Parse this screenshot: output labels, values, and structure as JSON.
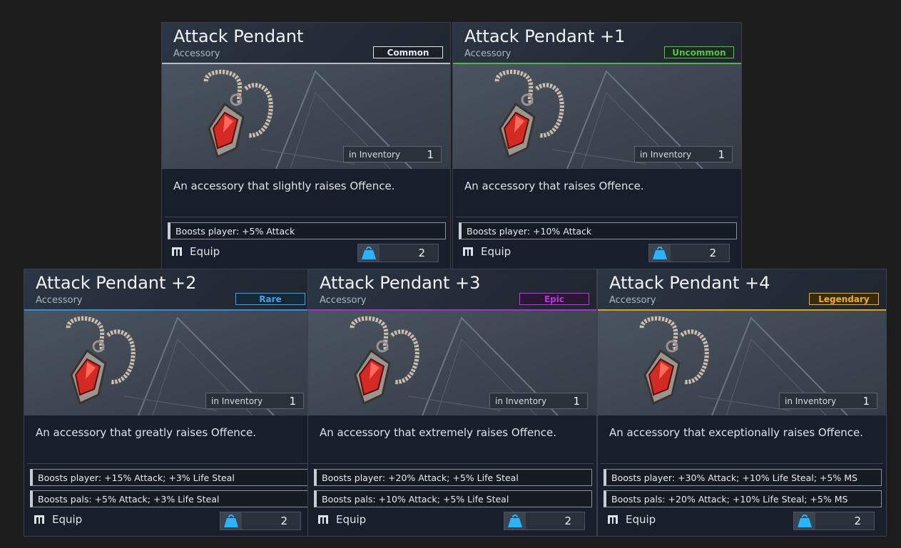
{
  "labels": {
    "category": "Accessory",
    "inventory_label": "in Inventory",
    "equip_label": "Equip"
  },
  "icons": {
    "item": "attack-pendant-icon",
    "equip": "equip-icon",
    "weight": "weight-icon"
  },
  "cards": [
    {
      "title": "Attack Pendant",
      "rarity": "Common",
      "rarity_color": "#e6e8eb",
      "rarity_bg": "#1b2028",
      "accent_color": "#b8bec6",
      "inventory_count": "1",
      "description": "An accessory that slightly raises Offence.",
      "boosts": [
        "Boosts player: +5% Attack"
      ],
      "weight": "2"
    },
    {
      "title": "Attack Pendant +1",
      "rarity": "Uncommon",
      "rarity_color": "#58c24a",
      "rarity_bg": "#1a2a1c",
      "accent_color": "#4fb845",
      "inventory_count": "1",
      "description": "An accessory that raises Offence.",
      "boosts": [
        "Boosts player: +10% Attack"
      ],
      "weight": "2"
    },
    {
      "title": "Attack Pendant +2",
      "rarity": "Rare",
      "rarity_color": "#3fa2ec",
      "rarity_bg": "#152838",
      "accent_color": "#2f8fdc",
      "inventory_count": "1",
      "description": "An accessory that greatly raises Offence.",
      "boosts": [
        "Boosts player: +15% Attack; +3% Life Steal",
        "Boosts pals: +5% Attack; +3% Life Steal"
      ],
      "weight": "2"
    },
    {
      "title": "Attack Pendant +3",
      "rarity": "Epic",
      "rarity_color": "#c234e0",
      "rarity_bg": "#2a1636",
      "accent_color": "#a92fd0",
      "inventory_count": "1",
      "description": "An accessory that extremely raises Offence.",
      "boosts": [
        "Boosts player: +20% Attack; +5% Life Steal",
        "Boosts pals: +10% Attack; +5% Life Steal"
      ],
      "weight": "2"
    },
    {
      "title": "Attack Pendant +4",
      "rarity": "Legendary",
      "rarity_color": "#f0b020",
      "rarity_bg": "#3a2a0c",
      "accent_color": "#e0a21a",
      "inventory_count": "1",
      "description": "An accessory that exceptionally raises Offence.",
      "boosts": [
        "Boosts player: +30% Attack; +10% Life Steal; +5% MS",
        "Boosts pals: +20% Attack; +10% Life Steal; +5% MS"
      ],
      "weight": "2"
    }
  ]
}
